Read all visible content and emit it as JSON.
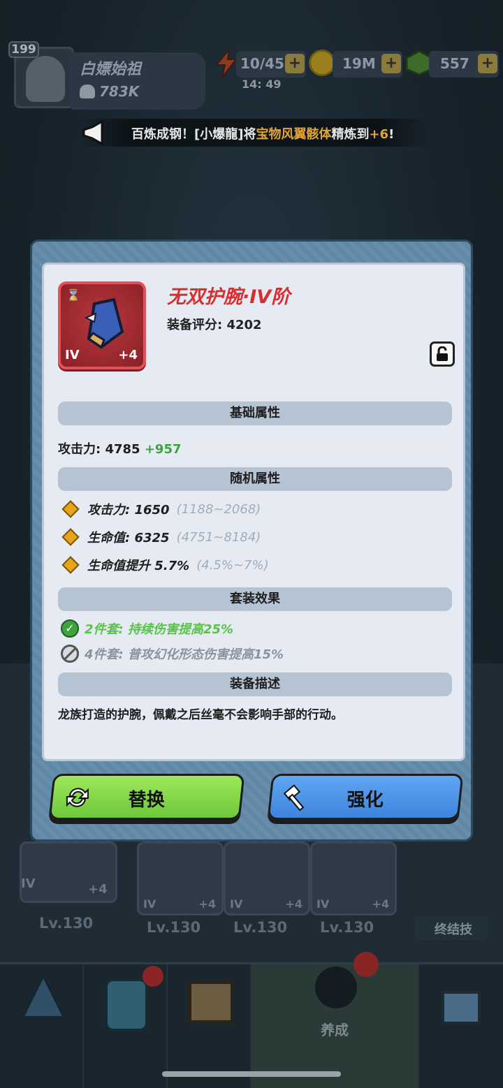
{
  "hud": {
    "player_level": "199",
    "player_name": "白嫖始祖",
    "player_power": "783K",
    "energy": "10/45",
    "energy_timer": "14: 49",
    "coins": "19M",
    "gems": "557",
    "plus_label": "+"
  },
  "marquee": {
    "prefix": "百炼成钢！[小爆龍]将",
    "item": "宝物风翼骸体",
    "middle": "精炼到",
    "level": "+6",
    "suffix": "!"
  },
  "item": {
    "name": "无双护腕·IV阶",
    "score_label": "装备评分: 4202",
    "tier": "IV",
    "enhance": "+4",
    "hourglass": "⌛"
  },
  "sections": {
    "base": "基础属性",
    "random": "随机属性",
    "set": "套装效果",
    "desc": "装备描述"
  },
  "base_stats": {
    "label": "攻击力: 4785 ",
    "bonus": "+957"
  },
  "random_stats": [
    {
      "text": "攻击力: 1650",
      "range": "(1188~2068)"
    },
    {
      "text": "生命值: 6325",
      "range": "(4751~8184)"
    },
    {
      "text": "生命值提升 5.7%",
      "range": "(4.5%~7%)"
    }
  ],
  "set_effects": [
    {
      "text": "2件套: 持续伤害提高25%",
      "active": true
    },
    {
      "text": "4件套: 普攻幻化形态伤害提高15%",
      "active": false
    }
  ],
  "description": "龙族打造的护腕，佩戴之后丝毫不会影响手部的行动。",
  "buttons": {
    "replace": "替换",
    "upgrade": "强化"
  },
  "background": {
    "slots": [
      {
        "tier": "IV",
        "plus": "+4",
        "level": "Lv.130"
      },
      {
        "tier": "IV",
        "plus": "+4",
        "level": "Lv.130"
      },
      {
        "tier": "IV",
        "plus": "+4",
        "level": "Lv.130"
      },
      {
        "tier": "IV",
        "plus": "+4",
        "level": "Lv.130"
      }
    ],
    "ultimate_label": "终结技",
    "nav_active_label": "养成"
  }
}
